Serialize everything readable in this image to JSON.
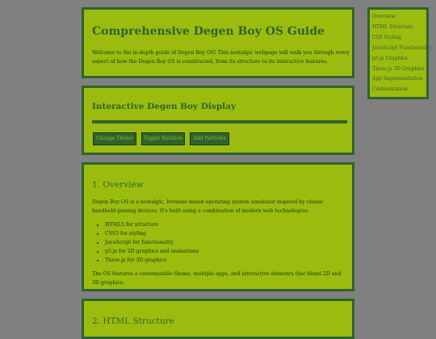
{
  "header": {
    "title": "Comprehensive Degen Boy OS Guide",
    "intro": "Welcome to the in-depth guide of Degen Boy OS! This nostalgic webpage will walk you through every aspect of how the Degen Boy OS is constructed, from its structure to its interactive features."
  },
  "display": {
    "title": "Interactive Degen Boy Display",
    "buttons": [
      "Change Theme",
      "Toggle Rotation",
      "Add Particles"
    ]
  },
  "overview": {
    "title": "1. Overview",
    "intro": "Degen Boy OS is a nostalgic, browser-based operating system simulator inspired by classic handheld gaming devices. It's built using a combination of modern web technologies:",
    "list": [
      "HTML5 for structure",
      "CSS3 for styling",
      "JavaScript for functionality",
      "p5.js for 2D graphics and animations",
      "Three.js for 3D graphics"
    ],
    "outro": "The OS features a customizable theme, multiple apps, and interactive elements that blend 2D and 3D graphics."
  },
  "html_section": {
    "title": "2. HTML Structure"
  },
  "toc": {
    "items": [
      "Overview",
      "HTML Structure",
      "CSS Styling",
      "JavaScript Functionality",
      "p5.js Graphics",
      "Three.js 3D Graphics",
      "App Implementation",
      "Customization"
    ]
  },
  "colors": {
    "background": "#808080",
    "panel": "#9bbc0f",
    "border": "#306230",
    "text": "#0f380f"
  }
}
